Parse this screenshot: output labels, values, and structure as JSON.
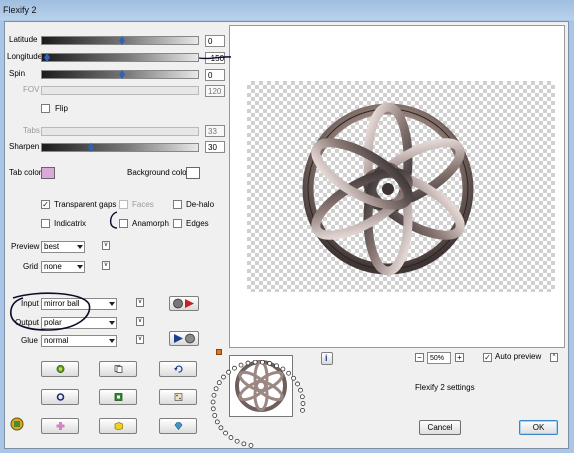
{
  "window": {
    "title": "Flexify 2"
  },
  "sliders": {
    "latitude": {
      "label": "Latitude",
      "value": "0",
      "level": 0.5
    },
    "longitude": {
      "label": "Longitude",
      "value": "-150",
      "level": 0.1
    },
    "spin": {
      "label": "Spin",
      "value": "0",
      "level": 0.5
    },
    "fov": {
      "label": "FOV",
      "value": "120",
      "disabled": true
    },
    "tabs": {
      "label": "Tabs",
      "value": "33",
      "disabled": true
    },
    "sharpen": {
      "label": "Sharpen",
      "value": "30",
      "level": 0.3
    }
  },
  "checkboxes": {
    "flip": {
      "label": "Flip",
      "checked": false
    },
    "transparent_gaps": {
      "label": "Transparent gaps",
      "checked": true
    },
    "faces": {
      "label": "Faces",
      "checked": false,
      "disabled": true
    },
    "de_halo": {
      "label": "De-halo",
      "checked": false
    },
    "indicatrix": {
      "label": "Indicatrix",
      "checked": false
    },
    "anamorph": {
      "label": "Anamorph",
      "checked": false
    },
    "edges": {
      "label": "Edges",
      "checked": false
    }
  },
  "colors": {
    "tab_label": "Tab color",
    "tab_value": "#dca8d9",
    "background_label": "Background color",
    "background_value": "#ffffff",
    "title_bar": "#a9c6e6",
    "annotation": "#0b0b2a"
  },
  "dropdowns": {
    "preview": {
      "label": "Preview",
      "value": "best"
    },
    "grid": {
      "label": "Grid",
      "value": "none"
    },
    "input": {
      "label": "Input",
      "value": "mirror ball"
    },
    "output": {
      "label": "Output",
      "value": "polar"
    },
    "glue": {
      "label": "Glue",
      "value": "normal"
    }
  },
  "tool_icons": [
    "globe-cube-icon",
    "copy-page-icon",
    "undo-icon",
    "ring-icon",
    "green-square-icon",
    "dice-icon",
    "pink-cross-icon",
    "yellow-cube-icon",
    "gem-icon"
  ],
  "preview_controls": {
    "zoom": "50%",
    "zoom_out": "−",
    "zoom_in": "+",
    "auto_preview_label": "Auto preview",
    "auto_preview_checked": true,
    "info": "i",
    "settings_text": "Flexify 2 settings"
  },
  "buttons": {
    "cancel": "Cancel",
    "ok": "OK"
  }
}
